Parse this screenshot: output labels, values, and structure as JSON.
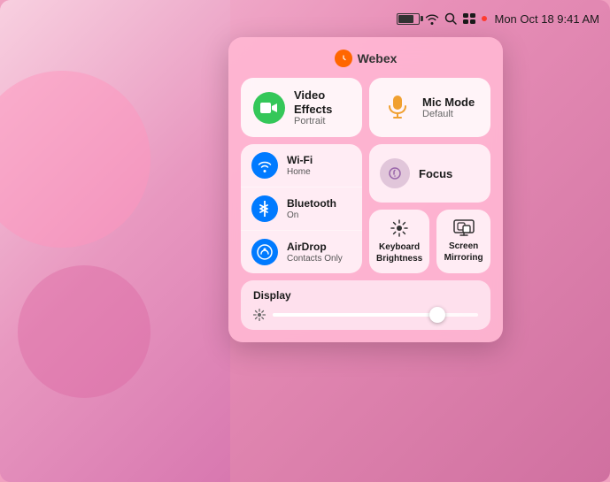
{
  "menubar": {
    "time": "Mon Oct 18  9:41 AM"
  },
  "webex": {
    "label": "Webex"
  },
  "video_effects": {
    "title": "Video Effects",
    "subtitle": "Portrait"
  },
  "mic_mode": {
    "title": "Mic Mode",
    "subtitle": "Default"
  },
  "wifi": {
    "title": "Wi-Fi",
    "subtitle": "Home"
  },
  "bluetooth": {
    "title": "Bluetooth",
    "subtitle": "On"
  },
  "airdrop": {
    "title": "AirDrop",
    "subtitle": "Contacts Only"
  },
  "focus": {
    "title": "Focus"
  },
  "keyboard_brightness": {
    "label": "Keyboard Brightness"
  },
  "screen_mirroring": {
    "label": "Screen Mirroring"
  },
  "display": {
    "label": "Display"
  }
}
